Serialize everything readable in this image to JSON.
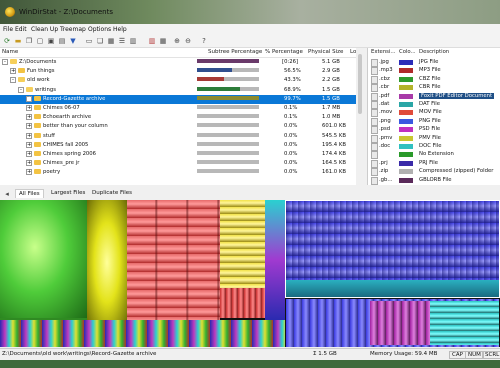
{
  "window": {
    "title": "WinDirStat - Z:\\Documents",
    "menu": [
      "File",
      "Edit",
      "Clean Up",
      "Treemap",
      "Options",
      "Help"
    ],
    "toolbar_icons": [
      "refresh-icon",
      "open-icon",
      "copy-icon",
      "explorer-icon",
      "cmd-icon",
      "properties-icon",
      "delete-recycle-icon",
      "delete-icon",
      "zoom-in-icon",
      "zoom-out-icon",
      "help-icon"
    ]
  },
  "file_tree": {
    "columns": {
      "name": "Name",
      "subtree_pct": "Subtree Percentage",
      "pct": "% Percentage",
      "size": "Physical Size",
      "lo": "Lo"
    },
    "rows": [
      {
        "name": "Z:\\Documents",
        "bar": "[0:26]",
        "pct": "",
        "size": "5.1 GB",
        "fill": 1.0,
        "color": "#6a3a6a",
        "level": 0,
        "expander": "-"
      },
      {
        "name": "Fun things",
        "bar": "",
        "pct": "56.5%",
        "size": "2.9 GB",
        "fill": 0.565,
        "color": "#2f4f8f",
        "level": 1,
        "expander": "+"
      },
      {
        "name": "old work",
        "bar": "",
        "pct": "43.3%",
        "size": "2.2 GB",
        "fill": 0.433,
        "color": "#a63a36",
        "level": 1,
        "expander": "-"
      },
      {
        "name": "writings",
        "bar": "",
        "pct": "68.9%",
        "size": "1.5 GB",
        "fill": 0.689,
        "color": "#2d7d3a",
        "level": 2,
        "expander": "-"
      },
      {
        "name": "Record-Gazette archive",
        "bar": "",
        "pct": "99.7%",
        "size": "1.5 GB",
        "fill": 0.997,
        "color": "#8b8b2f",
        "level": 3,
        "expander": "+",
        "selected": true
      },
      {
        "name": "Chimes 06-07",
        "bar": "",
        "pct": "0.1%",
        "size": "1.7 MB",
        "fill": 0.001,
        "color": "#8b8b2f",
        "level": 3,
        "expander": "+"
      },
      {
        "name": "Echoearth archive",
        "bar": "",
        "pct": "0.1%",
        "size": "1.0 MB",
        "fill": 0.001,
        "color": "#8b8b2f",
        "level": 3,
        "expander": "+"
      },
      {
        "name": "better than your column",
        "bar": "",
        "pct": "0.0%",
        "size": "601.0 KB",
        "fill": 0.0,
        "color": "#8b8b2f",
        "level": 3,
        "expander": "+"
      },
      {
        "name": "stuff",
        "bar": "",
        "pct": "0.0%",
        "size": "545.5 KB",
        "fill": 0.0,
        "color": "#8b8b2f",
        "level": 3,
        "expander": "+"
      },
      {
        "name": "CHIMES fall 2005",
        "bar": "",
        "pct": "0.0%",
        "size": "195.4 KB",
        "fill": 0.0,
        "color": "#8b8b2f",
        "level": 3,
        "expander": "+"
      },
      {
        "name": "Chimes spring 2006",
        "bar": "",
        "pct": "0.0%",
        "size": "174.4 KB",
        "fill": 0.0,
        "color": "#8b8b2f",
        "level": 3,
        "expander": "+"
      },
      {
        "name": "Chimes_pre jr",
        "bar": "",
        "pct": "0.0%",
        "size": "164.5 KB",
        "fill": 0.0,
        "color": "#8b8b2f",
        "level": 3,
        "expander": "+"
      },
      {
        "name": "poetry",
        "bar": "",
        "pct": "0.0%",
        "size": "161.0 KB",
        "fill": 0.0,
        "color": "#8b8b2f",
        "level": 3,
        "expander": "+"
      }
    ]
  },
  "extensions": {
    "columns": {
      "ext": "Extensi...",
      "color": "Colo...",
      "desc": "Description"
    },
    "rows": [
      {
        "ext": ".jpg",
        "color": "#2b2bb8",
        "desc": "JPG File"
      },
      {
        "ext": ".mp3",
        "color": "#b02a2a",
        "desc": "MP3 File"
      },
      {
        "ext": ".cbz",
        "color": "#2e9a2e",
        "desc": "CBZ File"
      },
      {
        "ext": ".cbr",
        "color": "#b3b32a",
        "desc": "CBR File"
      },
      {
        "ext": ".pdf",
        "color": "#a83aa8",
        "desc": "Foxit PDF Editor Document",
        "highlight": true
      },
      {
        "ext": ".dat",
        "color": "#2aa6a6",
        "desc": "DAT File"
      },
      {
        "ext": ".mov",
        "color": "#e04a3a",
        "desc": "MOV File"
      },
      {
        "ext": ".png",
        "color": "#3a58e0",
        "desc": "PNG File"
      },
      {
        "ext": ".psd",
        "color": "#c030c0",
        "desc": "PSD File"
      },
      {
        "ext": ".pmv",
        "color": "#c8c830",
        "desc": "PMV File"
      },
      {
        "ext": ".doc",
        "color": "#30c0c0",
        "desc": "DOC File"
      },
      {
        "ext": "",
        "color": "#2a9a2a",
        "desc": "No Extension"
      },
      {
        "ext": ".prj",
        "color": "#3a2aa8",
        "desc": "PRJ File"
      },
      {
        "ext": ".zip",
        "color": "#b0b0b0",
        "desc": "Compressed (zipped) Folder"
      },
      {
        "ext": ".gb...",
        "color": "#5a2a5a",
        "desc": "GBLORB File"
      }
    ]
  },
  "tabs": [
    "All Files",
    "Largest Files",
    "Duplicate Files"
  ],
  "status": {
    "path": "Z:\\Documents\\old work\\writings\\Record-Gazette archive",
    "sum": "Σ 1.5 GB",
    "memory": "Memory Usage: 59.4 MB",
    "caps": "CAP",
    "num": "NUM",
    "scrl": "SCRL"
  }
}
